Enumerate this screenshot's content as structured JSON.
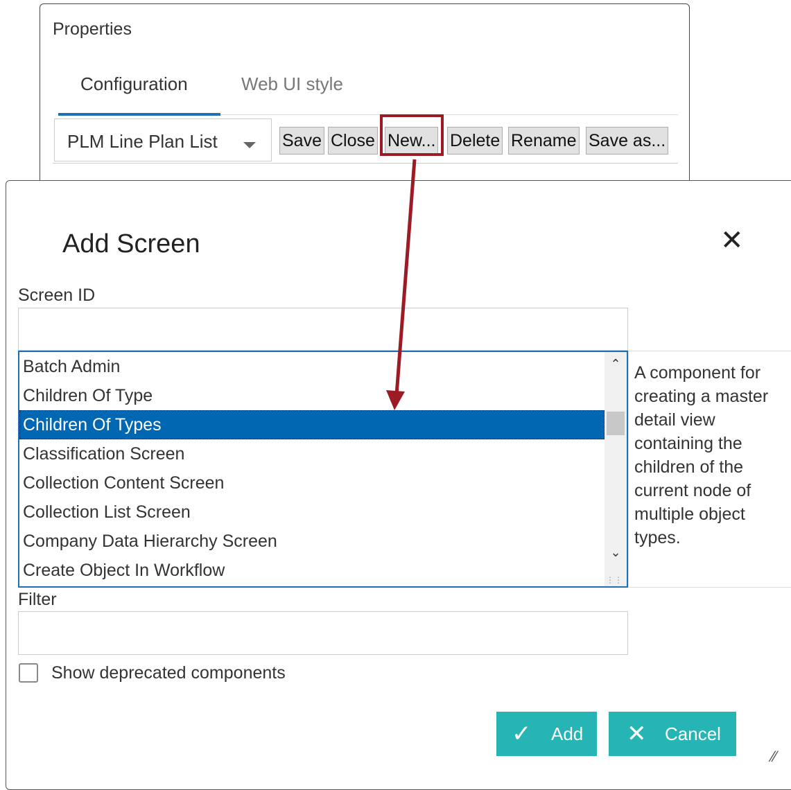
{
  "properties": {
    "title": "Properties",
    "tabs": [
      {
        "label": "Configuration",
        "active": true
      },
      {
        "label": "Web UI style",
        "active": false
      }
    ],
    "screen_dropdown": {
      "value": "PLM Line Plan List"
    },
    "toolbar": {
      "save": "Save",
      "close": "Close",
      "new": "New...",
      "delete": "Delete",
      "rename": "Rename",
      "save_as": "Save as..."
    }
  },
  "dialog": {
    "title": "Add Screen",
    "close_icon": "close-icon",
    "screen_id": {
      "label": "Screen ID",
      "value": ""
    },
    "list": {
      "items": [
        "Batch Admin",
        "Children Of Type",
        "Children Of Types",
        "Classification Screen",
        "Collection Content Screen",
        "Collection List Screen",
        "Company Data Hierarchy Screen",
        "Create Object In Workflow"
      ],
      "selected": "Children Of Types"
    },
    "description": "A component for creating a master detail view containing the children of the current node of multiple object types.",
    "filter": {
      "label": "Filter",
      "value": ""
    },
    "show_deprecated": {
      "label": "Show deprecated components",
      "checked": false
    },
    "buttons": {
      "add": "Add",
      "cancel": "Cancel"
    }
  },
  "colors": {
    "accent_teal": "#26b4b4",
    "selection_blue": "#0068b3",
    "annotation_red": "#9b1c24",
    "tab_underline": "#1f6fb5"
  }
}
